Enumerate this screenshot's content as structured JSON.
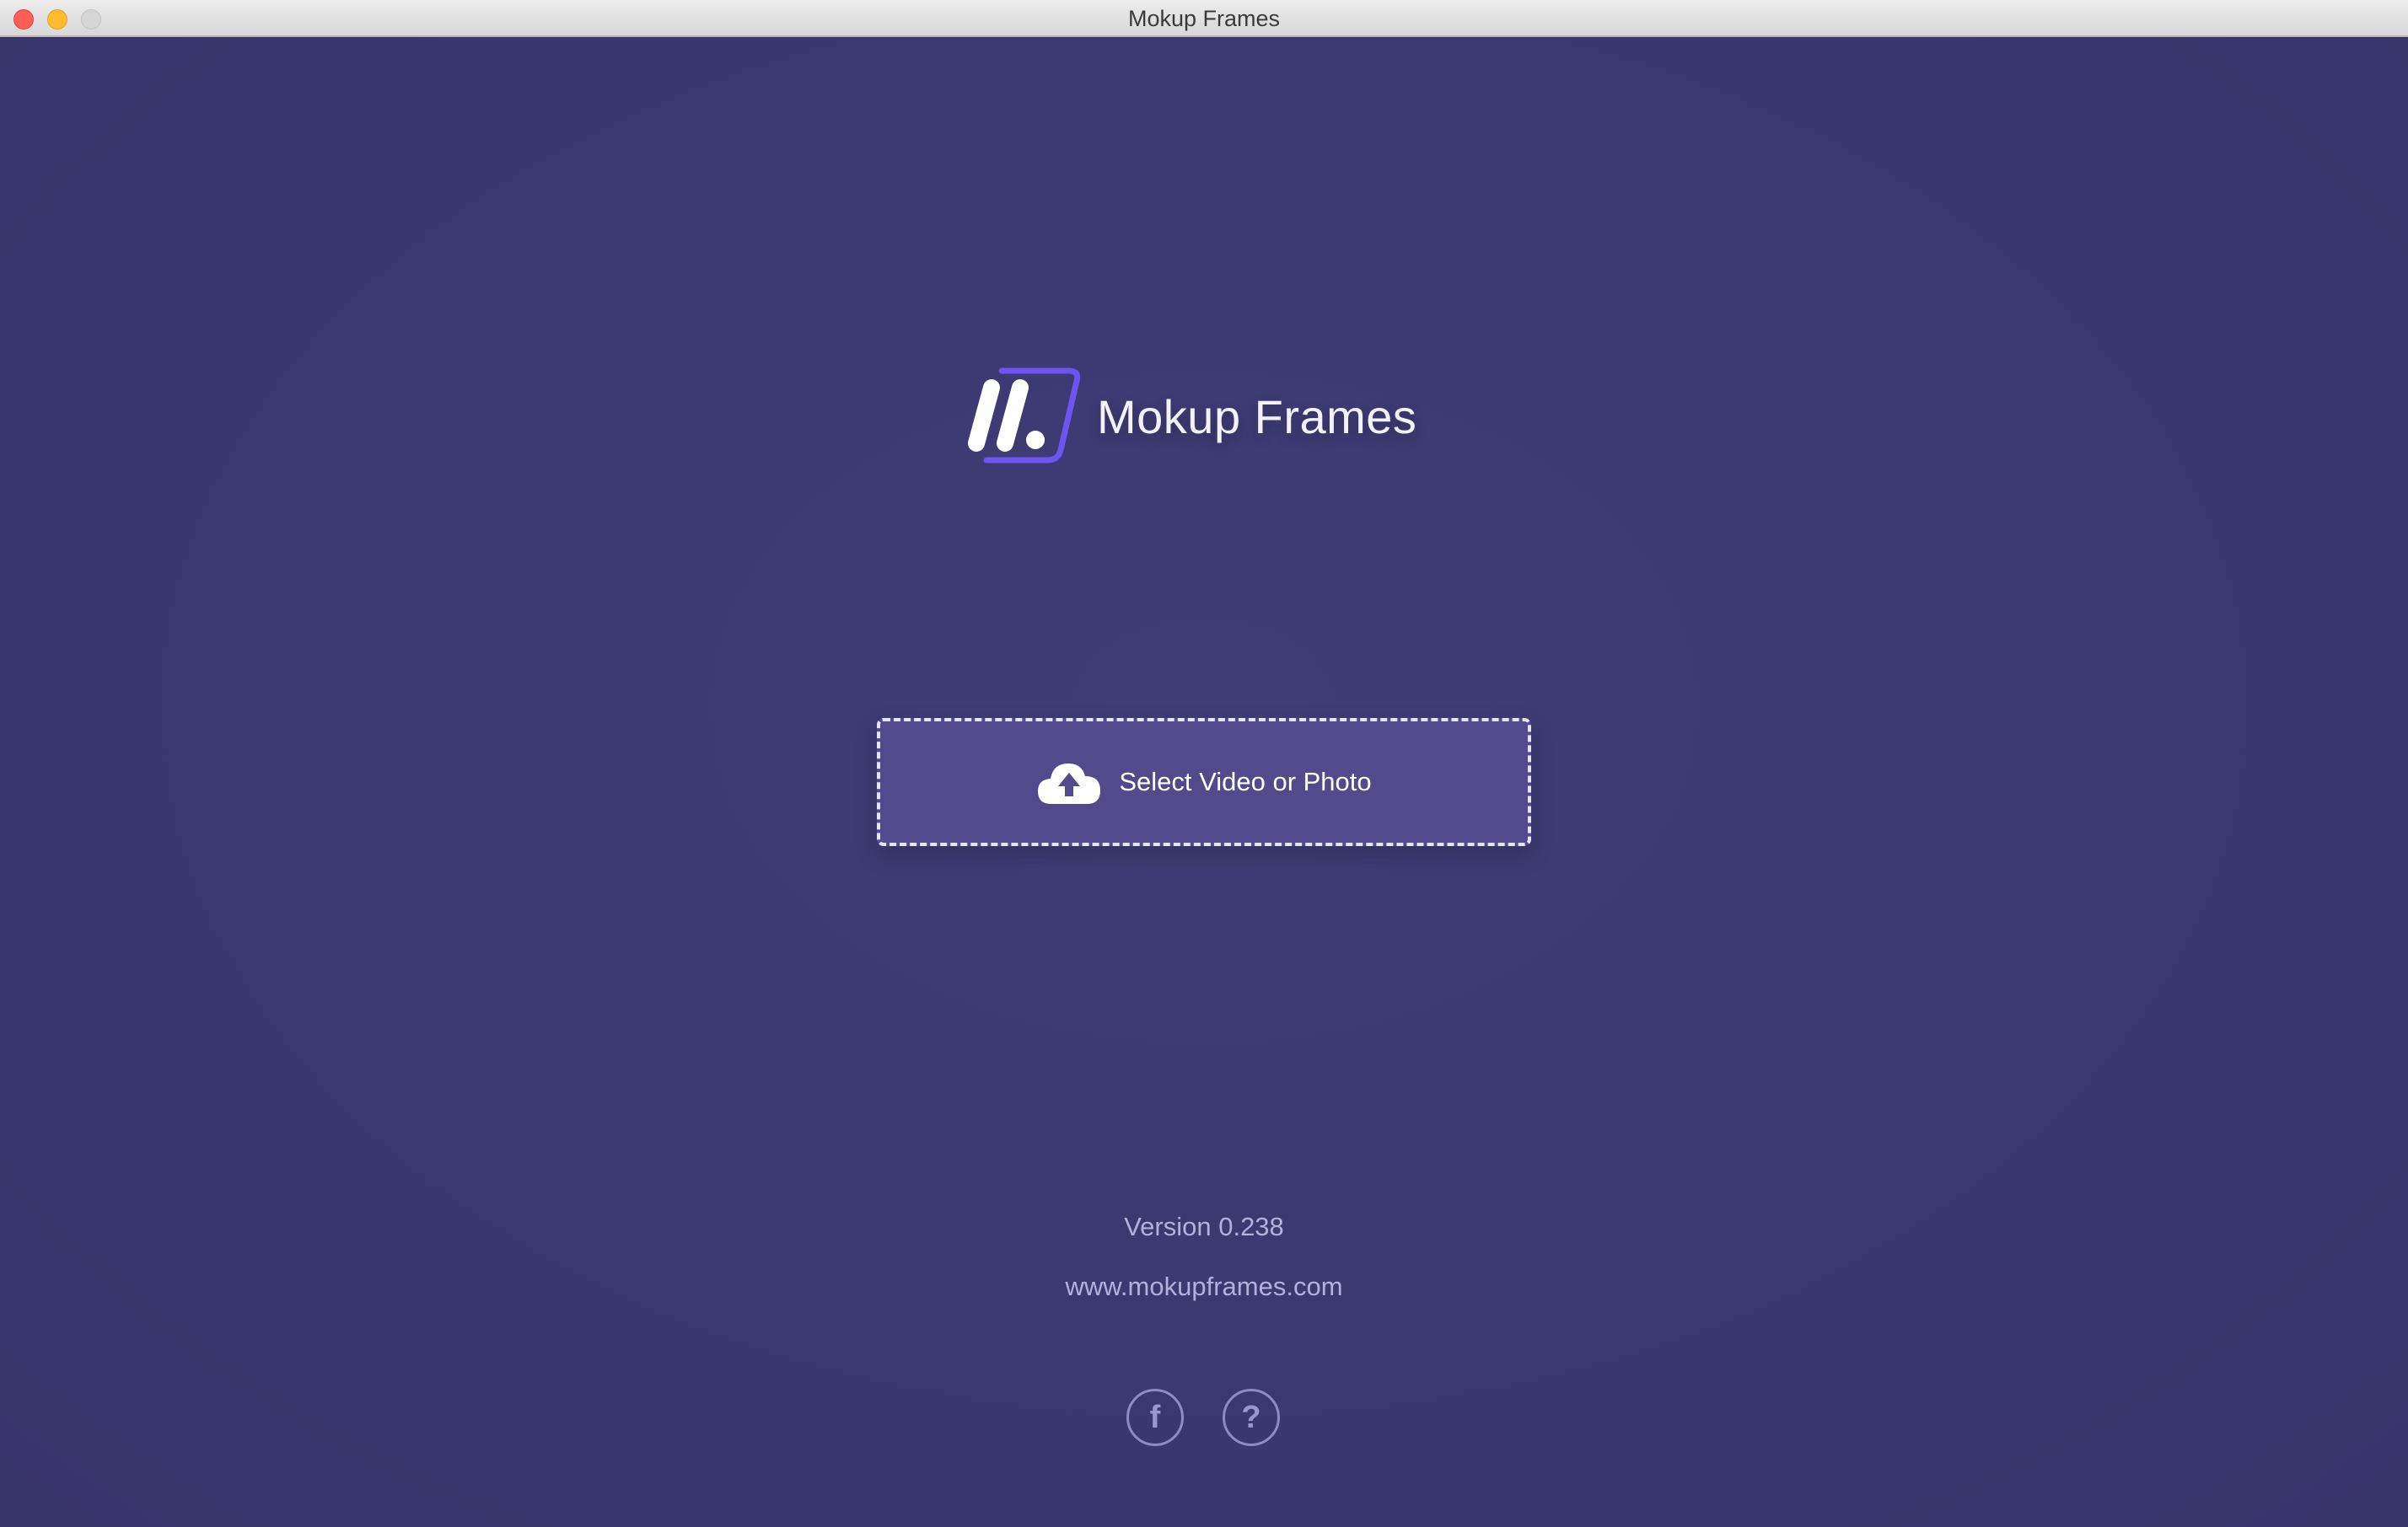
{
  "window": {
    "title": "Mokup Frames"
  },
  "brand": {
    "name": "Mokup Frames",
    "logo_icon": "mokup-frames-logo-icon"
  },
  "upload": {
    "label": "Select Video or Photo",
    "icon": "cloud-upload-icon"
  },
  "footer": {
    "version": "Version 0.238",
    "website": "www.mokupframes.com",
    "facebook_glyph": "f",
    "help_glyph": "?"
  },
  "colors": {
    "background": "#3b3870",
    "button_fill": "#524a8a",
    "logo_accent": "#6c55f0",
    "muted_text": "#b4b0dc"
  }
}
